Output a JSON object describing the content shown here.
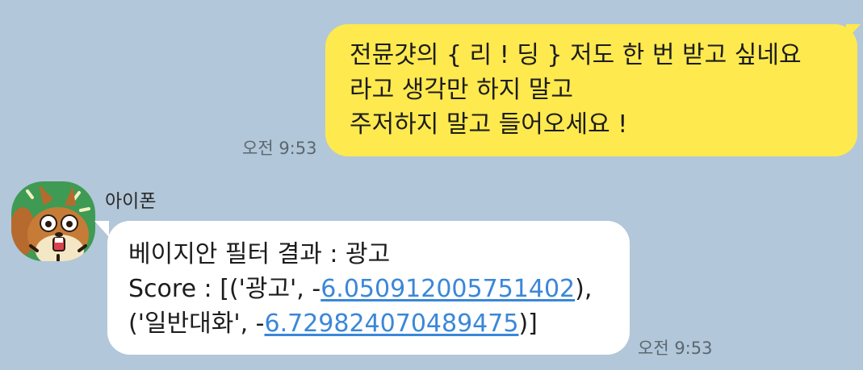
{
  "outgoing": {
    "lines": [
      "전뮨걋의 { 리 ! 딩 } 저도 한 번 받고 싶네요",
      "라고 생각만 하지 말고",
      "주저하지 말고 들어오세요 !"
    ],
    "time": "오전 9:53",
    "color": "#fee94f"
  },
  "incoming": {
    "sender": "아이폰",
    "line1": "베이지안 필터 결과 : 광고",
    "line2_prefix": "Score : [('광고', -",
    "line2_link": "6.050912005751402",
    "line2_suffix": "),",
    "line3_prefix": "('일반대화', -",
    "line3_link": "6.729824070489475",
    "line3_suffix": ")]",
    "time": "오전 9:53",
    "color": "#ffffff",
    "link_color": "#3a87d8"
  },
  "background_color": "#b2c7d9",
  "avatar": {
    "icon": "squirrel-icon"
  }
}
